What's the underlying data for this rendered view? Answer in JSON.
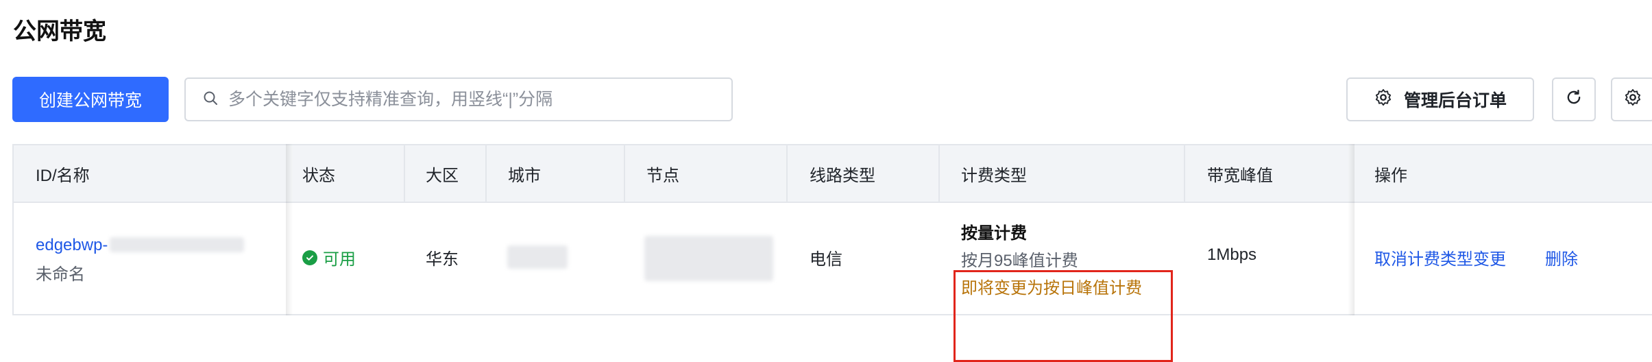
{
  "page": {
    "title": "公网带宽"
  },
  "toolbar": {
    "create_label": "创建公网带宽",
    "search_placeholder": "多个关键字仅支持精准查询，用竖线“|”分隔",
    "order_label": "管理后台订单"
  },
  "table": {
    "columns": [
      "ID/名称",
      "状态",
      "大区",
      "城市",
      "节点",
      "线路类型",
      "计费类型",
      "带宽峰值",
      "操作"
    ],
    "rows": [
      {
        "id": "edgebwp-",
        "name": "未命名",
        "status": "可用",
        "region": "华东",
        "city": "",
        "node": "",
        "line_type": "电信",
        "billing_type": "按量计费",
        "billing_sub": "按月95峰值计费",
        "billing_pending": "即将变更为按日峰值计费",
        "bandwidth_peak": "1Mbps",
        "actions": [
          "取消计费类型变更",
          "删除"
        ]
      }
    ]
  },
  "colors": {
    "primary": "#2f6bff",
    "link": "#1f58e6",
    "success": "#1a9e45",
    "pending": "#b8740a",
    "highlight": "#e1251b"
  }
}
